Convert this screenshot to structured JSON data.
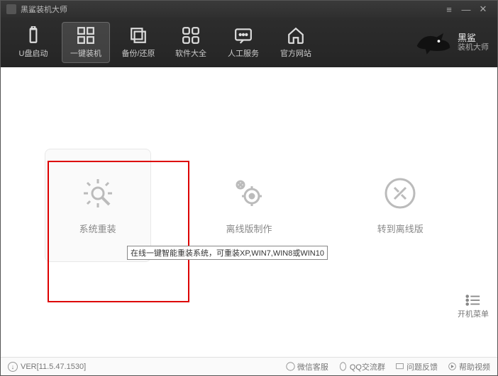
{
  "title": "黑鲨装机大师",
  "toolbar": [
    {
      "label": "U盘启动"
    },
    {
      "label": "一键装机"
    },
    {
      "label": "备份/还原"
    },
    {
      "label": "软件大全"
    },
    {
      "label": "人工服务"
    },
    {
      "label": "官方网站"
    }
  ],
  "brand": {
    "line1": "黑鲨",
    "line2": "装机大师"
  },
  "cards": [
    {
      "label": "系统重装"
    },
    {
      "label": "离线版制作"
    },
    {
      "label": "转到离线版"
    }
  ],
  "tooltip": "在线一键智能重装系统，可重装XP,WIN7,WIN8或WIN10",
  "startmenu": "开机菜单",
  "footer": {
    "version": "VER[11.5.47.1530]",
    "items": [
      {
        "label": "微信客服"
      },
      {
        "label": "QQ交流群"
      },
      {
        "label": "问题反馈"
      },
      {
        "label": "帮助视频"
      }
    ]
  }
}
